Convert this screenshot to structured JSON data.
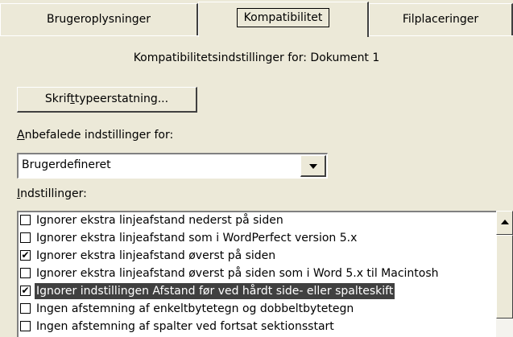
{
  "tabs": [
    {
      "label": "Brugeroplysninger"
    },
    {
      "label": "Kompatibilitet",
      "active": true
    },
    {
      "label": "Filplaceringer"
    }
  ],
  "header": "Kompatibilitetsindstillinger for: Dokument 1",
  "font_button": {
    "pre": "Skrif",
    "accel": "t",
    "post": "typeerstatning..."
  },
  "recommended": {
    "label_accel": "A",
    "label_rest": "nbefalede indstillinger for:",
    "value": "Brugerdefineret"
  },
  "options": {
    "label_accel": "I",
    "label_rest": "ndstillinger:",
    "items": [
      {
        "text": "Ignorer ekstra linjeafstand nederst på siden",
        "checked": false
      },
      {
        "text": "Ignorer ekstra linjeafstand som i WordPerfect version 5.x",
        "checked": false
      },
      {
        "text": "Ignorer ekstra linjeafstand øverst på siden",
        "checked": true
      },
      {
        "text": "Ignorer ekstra linjeafstand øverst på siden som i Word 5.x til Macintosh",
        "checked": false
      },
      {
        "text": "Ignorer indstillingen Afstand før ved hårdt side- eller spalteskift",
        "checked": true,
        "selected": true
      },
      {
        "text": "Ingen afstemning af enkeltbytetegn og dobbeltbytetegn",
        "checked": false
      },
      {
        "text": "Ingen afstemning af spalter ved fortsat sektionsstart",
        "checked": false
      }
    ]
  },
  "icons": {
    "dropdown": "chevron-down-icon",
    "scroll_up": "scroll-up-arrow-icon",
    "check": "checkmark-icon"
  }
}
